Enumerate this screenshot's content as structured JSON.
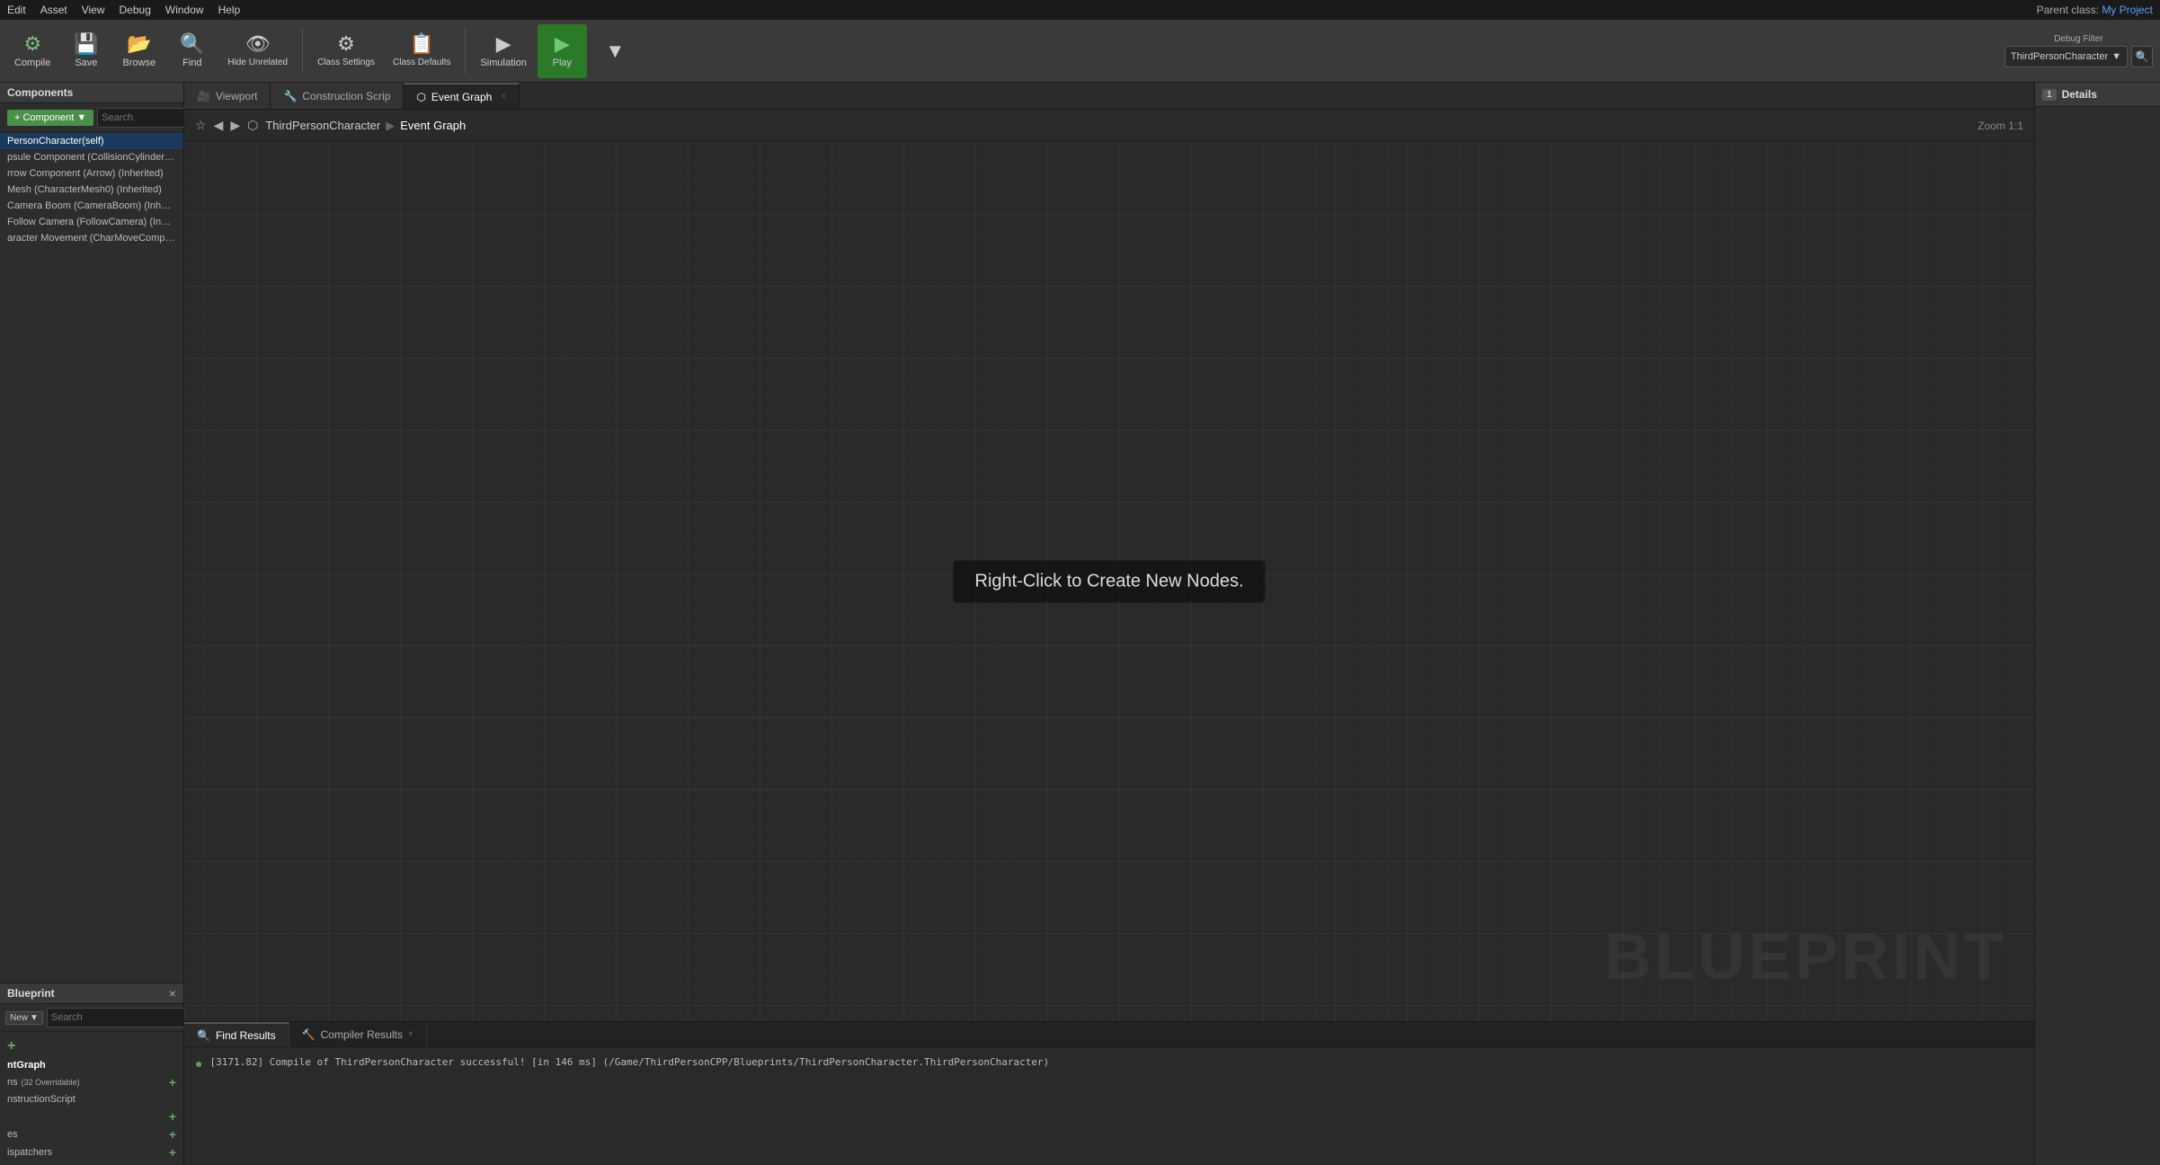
{
  "menu": {
    "items": [
      "Edit",
      "Asset",
      "View",
      "Debug",
      "Window",
      "Help"
    ],
    "parent_class": "Parent class:",
    "project": "My Project"
  },
  "toolbar": {
    "compile_label": "Compile",
    "save_label": "Save",
    "browse_label": "Browse",
    "find_label": "Find",
    "hide_unrelated_label": "Hide Unrelated",
    "class_settings_label": "Class Settings",
    "class_defaults_label": "Class Defaults",
    "simulation_label": "Simulation",
    "play_label": "Play",
    "debug_filter_label": "Debug Filter",
    "debug_filter_value": "ThirdPersonCharacter",
    "search_placeholder": "Search"
  },
  "left_panel": {
    "components_title": "Components",
    "component_btn_label": "Component",
    "search_placeholder": "Search",
    "components": [
      "PersonCharacter(self)",
      "psule Component (CollisionCylinder) (Inher",
      "rrow Component (Arrow) (Inherited)",
      "Mesh (CharacterMesh0) (Inherited)",
      "Camera Boom (CameraBoom) (Inherited)",
      "Follow Camera (FollowCamera) (Inherited)",
      "aracter Movement (CharMoveComp) (Inheri"
    ],
    "blueprint_title": "Blueprint",
    "view_btn": "New",
    "bp_search_placeholder": "Search",
    "tree_items": [
      {
        "label": "ntGraph",
        "badge": "",
        "has_add": false
      },
      {
        "label": "ns",
        "badge": "(32 Overridable)",
        "has_add": true
      },
      {
        "label": "nstructionScript",
        "badge": "",
        "has_add": false
      },
      {
        "label": "",
        "badge": "",
        "has_add": true
      },
      {
        "label": "es",
        "badge": "",
        "has_add": true
      },
      {
        "label": "ispatchers",
        "badge": "",
        "has_add": true
      }
    ]
  },
  "tabs": [
    {
      "label": "Viewport",
      "icon": "🎥",
      "active": false
    },
    {
      "label": "Construction Scrip",
      "icon": "🔧",
      "active": false
    },
    {
      "label": "Event Graph",
      "icon": "⬡",
      "active": true
    }
  ],
  "breadcrumb": {
    "path_root": "ThirdPersonCharacter",
    "path_sep": "▶",
    "path_current": "Event Graph",
    "zoom": "Zoom 1:1"
  },
  "graph": {
    "hint": "Right-Click to Create New Nodes.",
    "watermark": "BLUEPRINT"
  },
  "bottom_panel": {
    "tabs": [
      {
        "label": "Find Results",
        "icon": "🔍",
        "active": true,
        "closable": false
      },
      {
        "label": "Compiler Results",
        "icon": "🔨",
        "active": false,
        "closable": true
      }
    ],
    "log_entries": [
      {
        "text": "[3171.82] Compile of ThirdPersonCharacter successful! [in 146 ms] (/Game/ThirdPersonCPP/Blueprints/ThirdPersonCharacter.ThirdPersonCharacter)"
      }
    ]
  },
  "right_panel": {
    "title": "Details",
    "number": "1"
  }
}
